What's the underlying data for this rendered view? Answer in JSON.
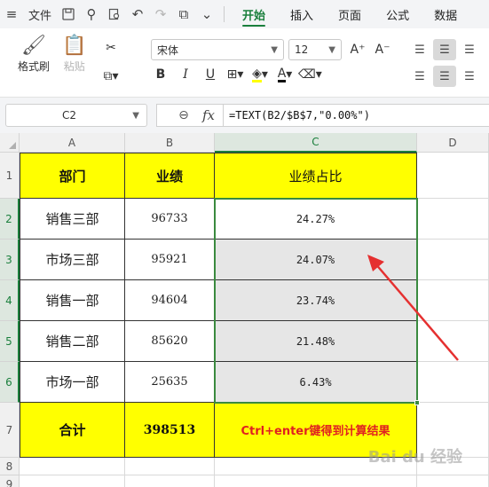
{
  "menubar": {
    "file_label": "文件",
    "tabs": [
      "开始",
      "插入",
      "页面",
      "公式",
      "数据"
    ],
    "active_tab": "开始"
  },
  "ribbon": {
    "format_painter": "格式刷",
    "paste": "粘贴",
    "font_name": "宋体",
    "font_size": "12"
  },
  "formula_bar": {
    "cell_ref": "C2",
    "formula": "=TEXT(B2/$B$7,\"0.00%\")"
  },
  "sheet": {
    "columns": [
      "A",
      "B",
      "C",
      "D"
    ],
    "rows": [
      "1",
      "2",
      "3",
      "4",
      "5",
      "6",
      "7",
      "8",
      "9"
    ],
    "header": {
      "dept": "部门",
      "perf": "业绩",
      "ratio": "业绩占比"
    },
    "data": [
      {
        "dept": "销售三部",
        "perf": "96733",
        "ratio": "24.27%"
      },
      {
        "dept": "市场三部",
        "perf": "95921",
        "ratio": "24.07%"
      },
      {
        "dept": "销售一部",
        "perf": "94604",
        "ratio": "23.74%"
      },
      {
        "dept": "销售二部",
        "perf": "85620",
        "ratio": "21.48%"
      },
      {
        "dept": "市场一部",
        "perf": "25635",
        "ratio": "6.43%"
      }
    ],
    "total": {
      "label": "合计",
      "value": "398513",
      "note": "Ctrl+enter键得到计算结果"
    }
  },
  "colors": {
    "accent": "#1a7f3c",
    "highlight": "#ffff00",
    "arrow": "#e53030"
  },
  "watermark": "Bai du 经验"
}
